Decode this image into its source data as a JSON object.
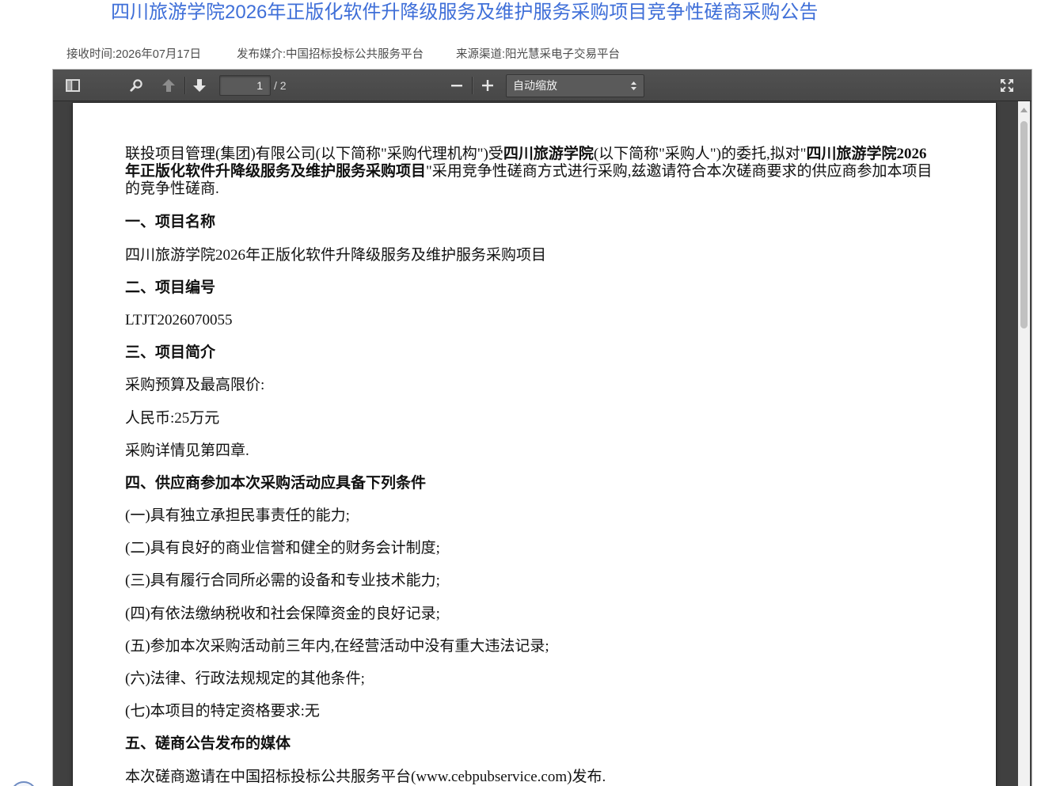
{
  "announcement": {
    "title": "四川旅游学院2026年正版化软件升降级服务及维护服务采购项目竞争性磋商采购公告",
    "meta": {
      "received_time": "接收时间:2026年07月17日",
      "published_media": "发布媒介:中国招标投标公共服务平台",
      "source_channel": "来源渠道:阳光慧采电子交易平台"
    }
  },
  "pdf_viewer": {
    "toolbar": {
      "icons": {
        "sidebar_toggle": "sidebar-toggle-icon",
        "search": "search-icon",
        "previous_page": "arrow-up-icon",
        "next_page": "arrow-down-icon",
        "zoom_out": "minus-icon",
        "zoom_in": "plus-icon",
        "zoom_select_caret": "select-caret-icon",
        "fullscreen": "fullscreen-icon"
      },
      "page_number": "1",
      "page_count": "/ 2",
      "zoom_select": {
        "selected": "自动缩放"
      }
    },
    "document": {
      "intro_lines": [
        [
          "联投项目管理(集团)有限公司(以下简称\"采购代理机构\")受",
          "四川旅游学院",
          "(以下简称\"采购人\")的委托,拟对\"",
          "四川旅游学院2026"
        ],
        [
          "年正版化软件升降级服务及维护服务采购项目",
          "\"采用竞争性磋商方式进行采购,兹邀请符合本次磋商要求的供应商参加本项目"
        ],
        [
          "的竞争性磋商."
        ]
      ],
      "sections": [
        {
          "heading": "一、项目名称",
          "lines": [
            "四川旅游学院2026年正版化软件升降级服务及维护服务采购项目"
          ]
        },
        {
          "heading": "二、项目编号",
          "lines": [
            "LTJT2026070055"
          ]
        },
        {
          "heading": "三、项目简介",
          "lines": [
            "采购预算及最高限价:",
            "人民币:25万元",
            "采购详情见第四章."
          ]
        },
        {
          "heading": "四、供应商参加本次采购活动应具备下列条件",
          "lines": [
            "(一)具有独立承担民事责任的能力;",
            "(二)具有良好的商业信誉和健全的财务会计制度;",
            "(三)具有履行合同所必需的设备和专业技术能力;",
            "(四)有依法缴纳税收和社会保障资金的良好记录;",
            "(五)参加本次采购活动前三年内,在经营活动中没有重大违法记录;",
            "(六)法律、行政法规规定的其他条件;",
            "(七)本项目的特定资格要求:无"
          ]
        },
        {
          "heading": "五、磋商公告发布的媒体",
          "lines": [
            "本次磋商邀请在中国招标投标公共服务平台(www.cebpubservice.com)发布."
          ]
        }
      ]
    },
    "scrollbar_icons": {
      "scroll_up": "triangle-up-icon"
    }
  },
  "floating_widget": {
    "icon": "circle-widget-icon"
  },
  "colors": {
    "title": "#3f6fd8",
    "meta_text": "#4d4d4d",
    "toolbar": "#474747",
    "viewer_background": "#404040",
    "page_background": "#ffffff",
    "body_text": "#111111"
  }
}
